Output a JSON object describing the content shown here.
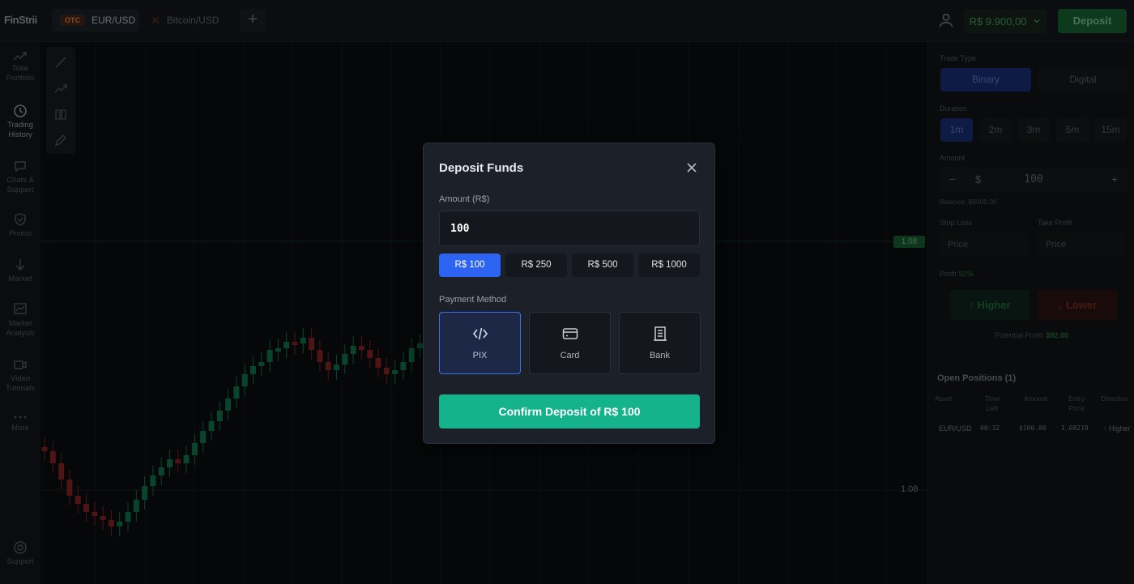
{
  "app": {
    "logo": "FinStrii"
  },
  "tabs": [
    {
      "badge": "OTC",
      "label": "EUR/USD"
    },
    {
      "icon": "bitcoin-icon",
      "label": "Bitcoin/USD"
    }
  ],
  "header": {
    "add_tab": "+",
    "balance": "R$ 9.900,00",
    "deposit_label": "Deposit"
  },
  "sidebar": {
    "items": [
      {
        "label": "Total Portfolio",
        "icon": "trending-up-icon"
      },
      {
        "label": "Trading History",
        "icon": "clock-icon"
      },
      {
        "label": "Chats & Support",
        "icon": "chat-icon"
      },
      {
        "label": "Promo",
        "icon": "shield-icon"
      },
      {
        "label": "Market",
        "icon": "arrow-down-icon"
      },
      {
        "label": "Market Analysis",
        "icon": "analysis-icon"
      },
      {
        "label": "Video Tutorials",
        "icon": "video-icon"
      },
      {
        "label": "More",
        "icon": "more-icon"
      },
      {
        "label": "Support",
        "icon": "support-icon"
      }
    ]
  },
  "chart": {
    "current_price": "1.08",
    "level_price": "1.08"
  },
  "trade_panel": {
    "trade_type_label": "Trade Type",
    "trade_types": [
      "Binary",
      "Digital"
    ],
    "duration_label": "Duration",
    "durations": [
      "1m",
      "2m",
      "3m",
      "5m",
      "15m"
    ],
    "amount_label": "Amount",
    "amount_minus": "−",
    "amount_currency": "$",
    "amount_value": "100",
    "amount_plus": "+",
    "balance_note": "Balance: $9900.00",
    "stop_loss_label": "Stop Loss",
    "take_profit_label": "Take Profit",
    "stop_loss_placeholder": "Price",
    "take_profit_placeholder": "Price",
    "profit_label": "Profit",
    "profit_value": "92%",
    "higher_label": "Higher",
    "lower_label": "Lower",
    "potential_profit_label": "Potential Profit:",
    "potential_profit_value": "$92.00"
  },
  "positions": {
    "title": "Open Positions (1)",
    "columns": [
      "Asset",
      "Time Left",
      "Amount",
      "Entry Price",
      "Direction"
    ],
    "rows": [
      {
        "asset": "EUR/USD",
        "time_left": "00:32",
        "amount": "$100.00",
        "entry_price": "1.08219",
        "direction": "Higher"
      }
    ]
  },
  "modal": {
    "title": "Deposit Funds",
    "amount_label": "Amount (R$)",
    "amount_value": "100",
    "quick_amounts": [
      "R$ 100",
      "R$ 250",
      "R$ 500",
      "R$ 1000"
    ],
    "payment_label": "Payment Method",
    "payment_methods": [
      {
        "label": "PIX",
        "icon": "pix-code-icon"
      },
      {
        "label": "Card",
        "icon": "card-icon"
      },
      {
        "label": "Bank",
        "icon": "bank-icon"
      }
    ],
    "confirm_label": "Confirm Deposit of R$ 100"
  },
  "colors": {
    "accent_blue": "#2c63f0",
    "confirm_green": "#14b38b",
    "candle_up": "#0f6b45",
    "candle_down": "#7a1f1f"
  }
}
